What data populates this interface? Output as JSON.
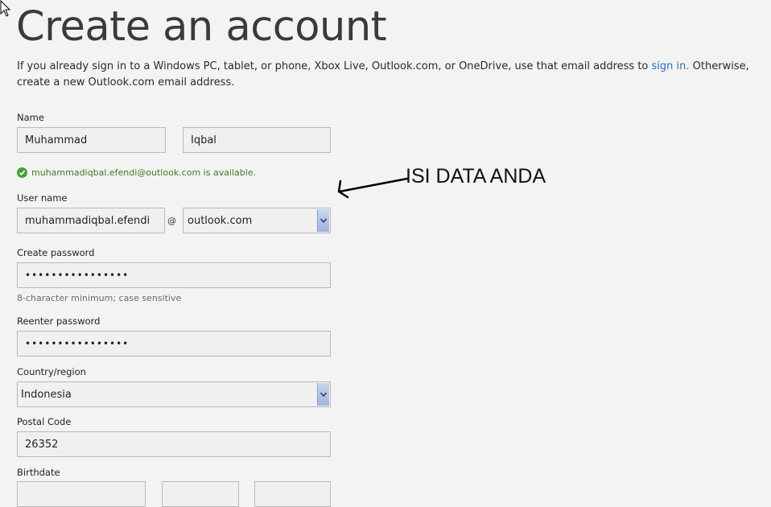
{
  "header": {
    "title": "Create an account"
  },
  "intro": {
    "text_before": "If you already sign in to a Windows PC, tablet, or phone, Xbox Live, Outlook.com, or OneDrive, use that email address to ",
    "link": "sign in.",
    "text_after": " Otherwise, create a new Outlook.com email address."
  },
  "name": {
    "label": "Name",
    "first": "Muhammad",
    "last": "Iqbal"
  },
  "availability": {
    "message": "muhammadiqbal.efendi@outlook.com is available.",
    "color": "#3f7a27"
  },
  "username": {
    "label": "User name",
    "value": "muhammadiqbal.efendi",
    "at": "@",
    "domain": "outlook.com"
  },
  "password": {
    "label": "Create password",
    "value": "••••••••••••••••",
    "hint": "8-character minimum; case sensitive"
  },
  "reenter": {
    "label": "Reenter password",
    "value": "••••••••••••••••"
  },
  "country": {
    "label": "Country/region",
    "value": "Indonesia"
  },
  "postal": {
    "label": "Postal Code",
    "value": "26352"
  },
  "birthdate": {
    "label": "Birthdate"
  },
  "annotation": {
    "text": "ISI DATA ANDA"
  },
  "colors": {
    "background": "#f3f3f3",
    "link": "#2371b8",
    "field_border": "#b9b9b9"
  },
  "icons": [
    "mouse-cursor-icon",
    "check-icon",
    "chevron-down-icon",
    "annotation-arrow-icon"
  ]
}
